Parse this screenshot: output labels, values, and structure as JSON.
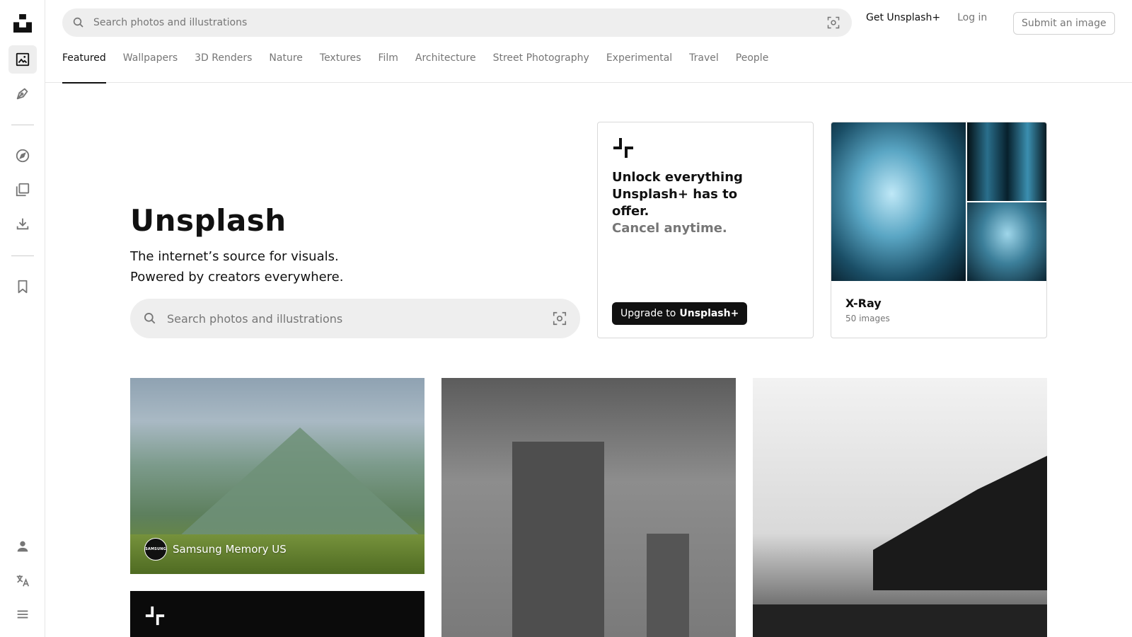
{
  "header": {
    "search_placeholder": "Search photos and illustrations",
    "get_plus_label": "Get Unsplash+",
    "login_label": "Log in",
    "submit_label": "Submit an image"
  },
  "sidebar": {
    "icons": [
      "unsplash-logo-icon",
      "photos-icon",
      "illustrations-icon",
      "explore-icon",
      "collections-icon",
      "download-icon",
      "bookmark-icon",
      "user-icon",
      "language-icon",
      "menu-icon"
    ]
  },
  "nav": {
    "categories": [
      "Featured",
      "Wallpapers",
      "3D Renders",
      "Nature",
      "Textures",
      "Film",
      "Architecture",
      "Street Photography",
      "Experimental",
      "Travel",
      "People"
    ],
    "active": "Featured"
  },
  "hero": {
    "title": "Unsplash",
    "subtitle_line1": "The internet’s source for visuals.",
    "subtitle_line2": "Powered by creators everywhere.",
    "search_placeholder": "Search photos and illustrations"
  },
  "plus_card": {
    "headline": "Unlock everything Unsplash+ has to offer.",
    "subline": "Cancel anytime.",
    "button_prefix": "Upgrade to",
    "button_brand": "Unsplash+"
  },
  "collection_card": {
    "title": "X-Ray",
    "count": "50 images"
  },
  "photos": [
    {
      "author": "Samsung Memory US",
      "avatar_text": "SAMSUNG"
    }
  ],
  "colors": {
    "text": "#111111",
    "muted": "#767676",
    "search_bg": "#eeeeee",
    "border": "#d9d9d9",
    "button_dark": "#111111"
  }
}
